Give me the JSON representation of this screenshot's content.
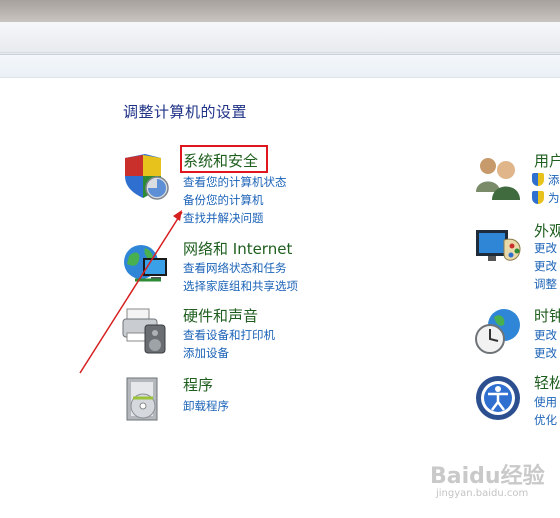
{
  "heading": "调整计算机的设置",
  "categories": [
    {
      "title": "系统和安全",
      "links": [
        "查看您的计算机状态",
        "备份您的计算机",
        "查找并解决问题"
      ]
    },
    {
      "title": "网络和 Internet",
      "links": [
        "查看网络状态和任务",
        "选择家庭组和共享选项"
      ]
    },
    {
      "title": "硬件和声音",
      "links": [
        "查看设备和打印机",
        "添加设备"
      ]
    },
    {
      "title": "程序",
      "links": [
        "卸载程序"
      ]
    }
  ],
  "right_categories": [
    {
      "title": "用户",
      "links": [
        "添",
        "为"
      ]
    },
    {
      "title": "外观",
      "links": [
        "更改",
        "更改",
        "调整"
      ]
    },
    {
      "title": "时钟",
      "links": [
        "更改",
        "更改"
      ]
    },
    {
      "title": "轻松",
      "links": [
        "使用",
        "优化"
      ]
    }
  ],
  "watermark": {
    "main": "Baidu经验",
    "sub": "jingyan.baidu.com"
  },
  "colors": {
    "highlight": "#e0161f",
    "arrow": "#d62020",
    "link": "#1c63b7",
    "title": "#1e5e1e"
  }
}
